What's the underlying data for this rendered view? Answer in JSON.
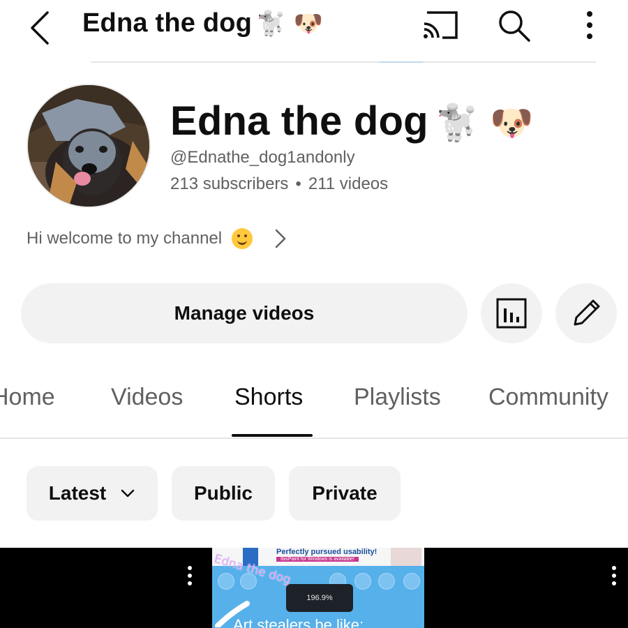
{
  "topbar": {
    "title": "Edna the dog",
    "title_emoji": "🐩 🐶"
  },
  "channel": {
    "name": "Edna the dog",
    "name_emoji": "🐩 🐶",
    "handle": "@Ednathe_dog1andonly",
    "subscribers": "213 subscribers",
    "separator": "•",
    "videos": "211 videos",
    "about": "Hi welcome to my channel"
  },
  "actions": {
    "manage_label": "Manage videos"
  },
  "tabs": [
    {
      "label": "Home"
    },
    {
      "label": "Videos"
    },
    {
      "label": "Shorts",
      "active": true
    },
    {
      "label": "Playlists"
    },
    {
      "label": "Community"
    }
  ],
  "filters": {
    "latest": "Latest",
    "public": "Public",
    "private": "Private"
  },
  "shorts": {
    "mid": {
      "banner_headline": "Perfectly pursued usability!",
      "banner_sub": "IbisPaint for Windows is available!",
      "sticker": "Edna the dog",
      "zoom": "196.9%",
      "caption": "Art stealers be like:"
    }
  },
  "colors": {
    "chip_bg": "#f2f2f2",
    "secondary_text": "#606060",
    "short_mid_bg": "#56b0ea"
  }
}
